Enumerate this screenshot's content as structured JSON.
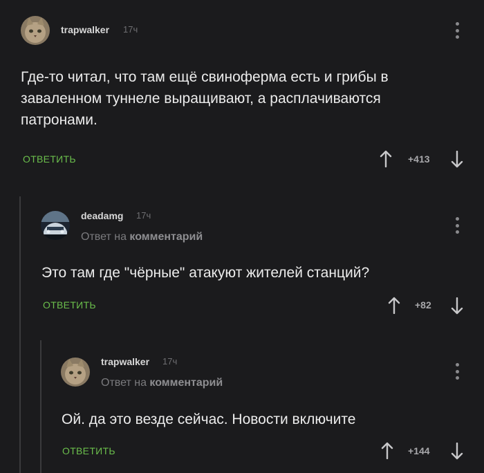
{
  "comments": [
    {
      "username": "trapwalker",
      "time": "17ч",
      "text": "Где-то читал, что там ещё свиноферма есть и грибы в заваленном туннеле выращивают, а расплачиваются патронами.",
      "reply_label": "ОТВЕТИТЬ",
      "rating": "+413",
      "avatar": "cat-avatar"
    },
    {
      "username": "deadamg",
      "time": "17ч",
      "reply_prefix": "Ответ на",
      "reply_target": "комментарий",
      "text": "Это там где \"чёрные\" атакуют жителей станций?",
      "reply_label": "ОТВЕТИТЬ",
      "rating": "+82",
      "avatar": "car-avatar"
    },
    {
      "username": "trapwalker",
      "time": "17ч",
      "reply_prefix": "Ответ на",
      "reply_target": "комментарий",
      "text": "Ой. да это везде сейчас. Новости включите",
      "reply_label": "ОТВЕТИТЬ",
      "rating": "+144",
      "avatar": "cat-avatar"
    }
  ],
  "colors": {
    "background": "#1b1b1d",
    "accent": "#6bbf4c",
    "thread_line": "#3a3a3c"
  }
}
